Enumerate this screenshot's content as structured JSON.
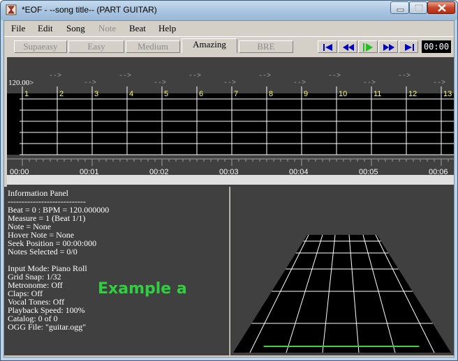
{
  "window": {
    "title": "*EOF - --song title-- (PART GUITAR)"
  },
  "menu": [
    {
      "label": "File",
      "enabled": true
    },
    {
      "label": "Edit",
      "enabled": true
    },
    {
      "label": "Song",
      "enabled": true
    },
    {
      "label": "Note",
      "enabled": false
    },
    {
      "label": "Beat",
      "enabled": true
    },
    {
      "label": "Help",
      "enabled": true
    }
  ],
  "difficulty_tabs": [
    {
      "label": "Supaeasy",
      "active": false
    },
    {
      "label": "Easy",
      "active": false
    },
    {
      "label": "Medium",
      "active": false
    },
    {
      "label": "Amazing",
      "active": true
    },
    {
      "label": "BRE",
      "active": false
    }
  ],
  "transport": {
    "buttons": [
      "seek-start-icon",
      "rewind-icon",
      "play-icon",
      "fast-forward-icon",
      "seek-end-icon"
    ],
    "time": "00:00"
  },
  "editor": {
    "bpm_label": "120.00>",
    "tempo_arrow": "-->",
    "measure_numbers": [
      "1",
      "2",
      "3",
      "4",
      "5",
      "6",
      "7",
      "8",
      "9",
      "10",
      "11",
      "12",
      "13"
    ],
    "time_labels": [
      "00:00",
      "00:01",
      "00:02",
      "00:03",
      "00:04",
      "00:05",
      "00:06"
    ]
  },
  "info_panel": {
    "lines": [
      "Information Panel",
      "----------------------------",
      "Beat = 0 : BPM = 120.000000",
      "Measure = 1 (Beat 1/1)",
      "Note = None",
      "Hover Note = None",
      "Seek Position = 00:00:000",
      "Notes Selected = 0/0",
      "",
      "Input Mode: Piano Roll",
      "Grid Snap: 1/32",
      "Metronome: Off",
      "Claps: Off",
      "Vocal Tones: Off",
      "Playback Speed: 100%",
      "Catalog: 0 of 0",
      "OGG File: \"guitar.ogg\""
    ],
    "overlay_text": "Example a"
  },
  "colors": {
    "accent_green": "#2fcf3f",
    "transport_blue": "#0000c0",
    "measure_number": "#ffff66"
  }
}
